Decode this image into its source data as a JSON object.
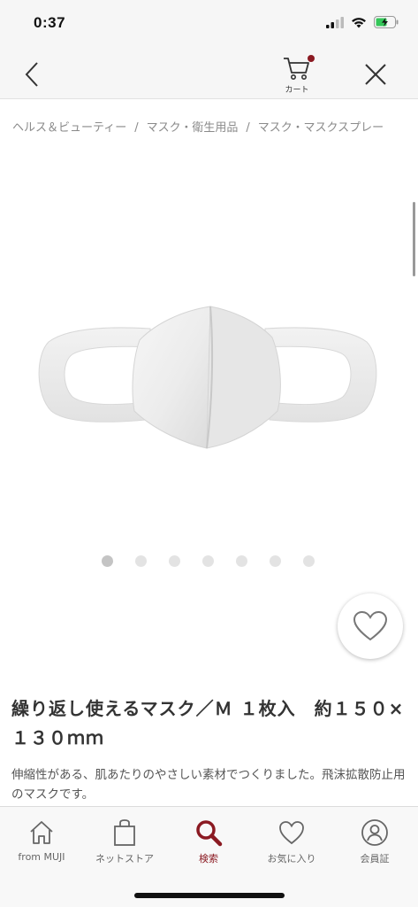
{
  "status_bar": {
    "time": "0:37"
  },
  "header": {
    "cart_label": "カート",
    "cart_has_items": true
  },
  "breadcrumb": [
    "ヘルス＆ビューティー",
    "マスク・衛生用品",
    "マスク・マスクスプレー"
  ],
  "breadcrumb_separator": "/",
  "gallery": {
    "total_images": 7,
    "current_index": 1
  },
  "product": {
    "title": "繰り返し使えるマスク／Ｍ １枚入　約１５０×１３０ｍｍ",
    "description": "伸縮性がある、肌あたりのやさしい素材でつくりました。飛沫拡散防止用のマスクです。"
  },
  "tabs": [
    {
      "label": "from MUJI",
      "icon": "home-icon",
      "active": false
    },
    {
      "label": "ネットストア",
      "icon": "shopping-bag-icon",
      "active": false
    },
    {
      "label": "検索",
      "icon": "search-icon",
      "active": true
    },
    {
      "label": "お気に入り",
      "icon": "heart-icon",
      "active": false
    },
    {
      "label": "会員証",
      "icon": "member-card-icon",
      "active": false
    }
  ],
  "colors": {
    "accent": "#8b1a22",
    "header_bg": "#f6f6f6",
    "text": "#333333",
    "muted": "#8a8a8a"
  }
}
